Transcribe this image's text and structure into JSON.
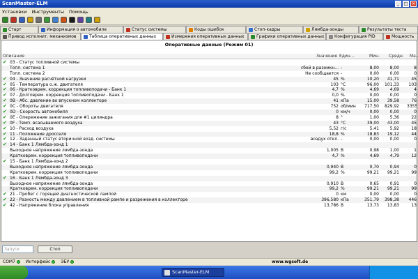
{
  "window": {
    "title": "ScanMaster-ELM"
  },
  "menu": [
    "Установки",
    "Инструменты",
    "Помощь"
  ],
  "tabs_top": [
    {
      "label": "Старт",
      "icon": "start-icon",
      "color": "#2a8a2a"
    },
    {
      "label": "Информация о автомобиле",
      "icon": "car-info-icon",
      "color": "#3060c0"
    },
    {
      "label": "Статус системы",
      "icon": "system-status-icon",
      "color": "#c03020"
    },
    {
      "label": "Коды ошибок",
      "icon": "error-codes-icon",
      "color": "#e08000"
    },
    {
      "label": "Стоп-кадры",
      "icon": "freeze-frame-icon",
      "color": "#3070d0"
    },
    {
      "label": "Лямбда-зонды",
      "icon": "lambda-icon",
      "color": "#d0a000"
    },
    {
      "label": "Результаты теста",
      "icon": "test-results-icon",
      "color": "#2a8a2a"
    }
  ],
  "tabs_bottom": [
    {
      "label": "Привод исполнит. механизмов",
      "icon": "actuator-icon",
      "color": "#555555"
    },
    {
      "label": "Таблица оперативных данных",
      "icon": "table-icon",
      "color": "#3060c0",
      "active": true
    },
    {
      "label": "Измерения оперативных данных",
      "icon": "gauge-icon",
      "color": "#c03020"
    },
    {
      "label": "Графики оперативных данных",
      "icon": "graph-icon",
      "color": "#2a8a2a"
    },
    {
      "label": "Конфигурация PID",
      "icon": "pid-config-icon",
      "color": "#888888"
    },
    {
      "label": "Мощность",
      "icon": "power-icon",
      "color": "#c03020"
    }
  ],
  "panel": {
    "title": "Оперативные данные (Режим 01)",
    "headers": {
      "desc": "Описание",
      "value": "Значение",
      "unit": "Един...",
      "min": "Мин.",
      "avg": "Средн.",
      "max": "Ма..."
    },
    "rows": [
      {
        "chk": true,
        "desc": "03 - Статус топливной системы",
        "value": "",
        "unit": "",
        "min": "",
        "avg": "",
        "max": ""
      },
      {
        "chk": false,
        "desc": "Топл. система 1",
        "value": "сбой в разомкн...",
        "unit": "-",
        "min": "8,00",
        "avg": "8,00",
        "max": "8"
      },
      {
        "chk": false,
        "desc": "Топл. система 2",
        "value": "Не сообщается",
        "unit": "-",
        "min": "0,00",
        "avg": "0,00",
        "max": "0"
      },
      {
        "chk": true,
        "desc": "04 - Значение расчётной нагрузки",
        "value": "45",
        "unit": "%",
        "min": "10,20",
        "avg": "41,71",
        "max": "45"
      },
      {
        "chk": true,
        "desc": "05 - Температура о.ж. двигателя",
        "value": "103",
        "unit": "°C",
        "min": "96,00",
        "avg": "101,33",
        "max": "103"
      },
      {
        "chk": true,
        "desc": "06 - Кратковрем. коррекция топливоподачи - Банк 1",
        "value": "4,7",
        "unit": "%",
        "min": "4,69",
        "avg": "4,69",
        "max": "4"
      },
      {
        "chk": true,
        "desc": "07 - Долговрем. коррекция топливоподачи - Банк 1",
        "value": "0,0",
        "unit": "%",
        "min": "0,00",
        "avg": "0,00",
        "max": "0"
      },
      {
        "chk": true,
        "desc": "0B - Абс. давление во впускном коллекторе",
        "value": "41",
        "unit": "кПа",
        "min": "15,00",
        "avg": "39,58",
        "max": "76"
      },
      {
        "chk": true,
        "desc": "0C - Обороты двигателя",
        "value": "752",
        "unit": "об/мин",
        "min": "717,50",
        "avg": "829,92",
        "max": "3355"
      },
      {
        "chk": true,
        "desc": "0D - Скорость автомобиля",
        "value": "0",
        "unit": "км/ч",
        "min": "0,00",
        "avg": "0,00",
        "max": "0"
      },
      {
        "chk": true,
        "desc": "0E - Опережение зажигания для #1 цилиндра",
        "value": "8",
        "unit": "°",
        "min": "1,00",
        "avg": "5,36",
        "max": "22"
      },
      {
        "chk": true,
        "desc": "0F - Темп. всасываемого воздуха",
        "value": "43",
        "unit": "°C",
        "min": "39,00",
        "avg": "43,00",
        "max": "45"
      },
      {
        "chk": true,
        "desc": "10 - Расход воздуха",
        "value": "5,52",
        "unit": "г/с",
        "min": "5,41",
        "avg": "5,92",
        "max": "18"
      },
      {
        "chk": true,
        "desc": "11 - Положение дросселя",
        "value": "18,8",
        "unit": "%",
        "min": "18,83",
        "avg": "19,12",
        "max": "44"
      },
      {
        "chk": true,
        "desc": "12 - Заданный статус вторичной возд. системы",
        "value": "воздух откл.",
        "unit": "-",
        "min": "0,00",
        "avg": "0,00",
        "max": "0"
      },
      {
        "chk": true,
        "desc": "14 - Банк 1 Лямбда-зонд 1",
        "value": "",
        "unit": "",
        "min": "",
        "avg": "",
        "max": ""
      },
      {
        "chk": false,
        "desc": "Выходное напряжение лямбда-зонда",
        "value": "1,005",
        "unit": "В",
        "min": "0,98",
        "avg": "1,00",
        "max": "1"
      },
      {
        "chk": false,
        "desc": "Кратковрем. коррекция топливоподачи",
        "value": "4,7",
        "unit": "%",
        "min": "4,69",
        "avg": "4,79",
        "max": "12"
      },
      {
        "chk": true,
        "desc": "15 - Банк 1 Лямбда-зонд 2",
        "value": "",
        "unit": "",
        "min": "",
        "avg": "",
        "max": ""
      },
      {
        "chk": false,
        "desc": "Выходное напряжение лямбда-зонда",
        "value": "0,940",
        "unit": "В",
        "min": "0,70",
        "avg": "0,94",
        "max": "0"
      },
      {
        "chk": false,
        "desc": "Кратковрем. коррекция топливоподачи",
        "value": "99,2",
        "unit": "%",
        "min": "99,21",
        "avg": "99,21",
        "max": "99"
      },
      {
        "chk": true,
        "desc": "16 - Банк 1 Лямбда-зонд 3",
        "value": "",
        "unit": "",
        "min": "",
        "avg": "",
        "max": ""
      },
      {
        "chk": false,
        "desc": "Выходное напряжение лямбда-зонда",
        "value": "0,910",
        "unit": "В",
        "min": "0,65",
        "avg": "0,91",
        "max": "0"
      },
      {
        "chk": false,
        "desc": "Кратковрем. коррекция топливоподачи",
        "value": "99,2",
        "unit": "%",
        "min": "99,21",
        "avg": "99,21",
        "max": "99"
      },
      {
        "chk": true,
        "desc": "21 - Пробег с горящей диагностической лампой",
        "value": "0",
        "unit": "км",
        "min": "0,00",
        "avg": "0,00",
        "max": "0"
      },
      {
        "chk": true,
        "desc": "22 - Разность между давлением в топливной рампе и разрежения в коллекторе",
        "value": "396,580",
        "unit": "кПа",
        "min": "351,79",
        "avg": "398,38",
        "max": "446"
      },
      {
        "chk": true,
        "desc": "42 - Напряжение блока управления",
        "value": "13,786",
        "unit": "В",
        "min": "13,73",
        "avg": "13,83",
        "max": "13"
      }
    ]
  },
  "bottom": {
    "input_placeholder": "Запуск",
    "stop_label": "Стоп"
  },
  "statusbar": {
    "items": [
      "COM7",
      "Интерфейс",
      "ЭБУ"
    ],
    "url": "www.wgsoft.de"
  },
  "taskbar": {
    "task_label": "ScanMaster-ELM"
  }
}
